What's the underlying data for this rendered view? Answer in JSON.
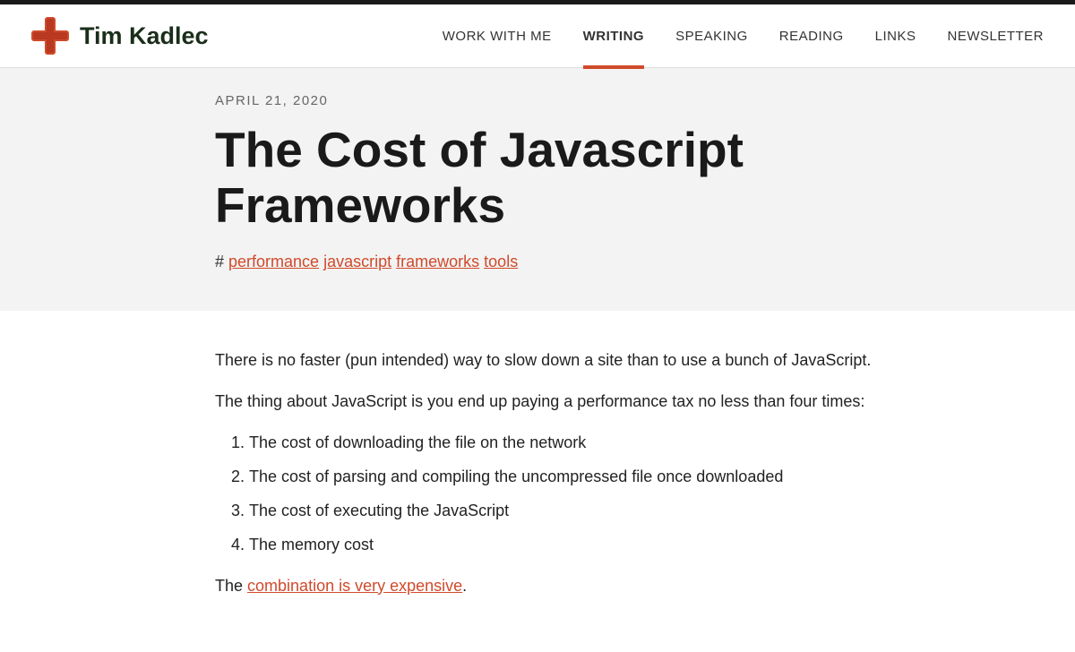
{
  "site": {
    "title": "Tim Kadlec"
  },
  "nav": {
    "items": [
      {
        "label": "WORK WITH ME",
        "active": false
      },
      {
        "label": "WRITING",
        "active": true
      },
      {
        "label": "SPEAKING",
        "active": false
      },
      {
        "label": "READING",
        "active": false
      },
      {
        "label": "LINKS",
        "active": false
      },
      {
        "label": "NEWSLETTER",
        "active": false
      }
    ]
  },
  "article": {
    "date": "APRIL 21, 2020",
    "title": "The Cost of Javascript Frameworks",
    "tag_prefix": "# ",
    "tags": [
      "performance",
      "javascript",
      "frameworks",
      "tools"
    ],
    "intro_1": "There is no faster (pun intended) way to slow down a site than to use a bunch of JavaScript.",
    "intro_2": "The thing about JavaScript is you end up paying a performance tax no less than four times:",
    "list": [
      "The cost of downloading the file on the network",
      "The cost of parsing and compiling the uncompressed file once downloaded",
      "The cost of executing the JavaScript",
      "The memory cost"
    ],
    "closing_prefix": "The ",
    "closing_link": "combination is very expensive",
    "closing_suffix": "."
  }
}
